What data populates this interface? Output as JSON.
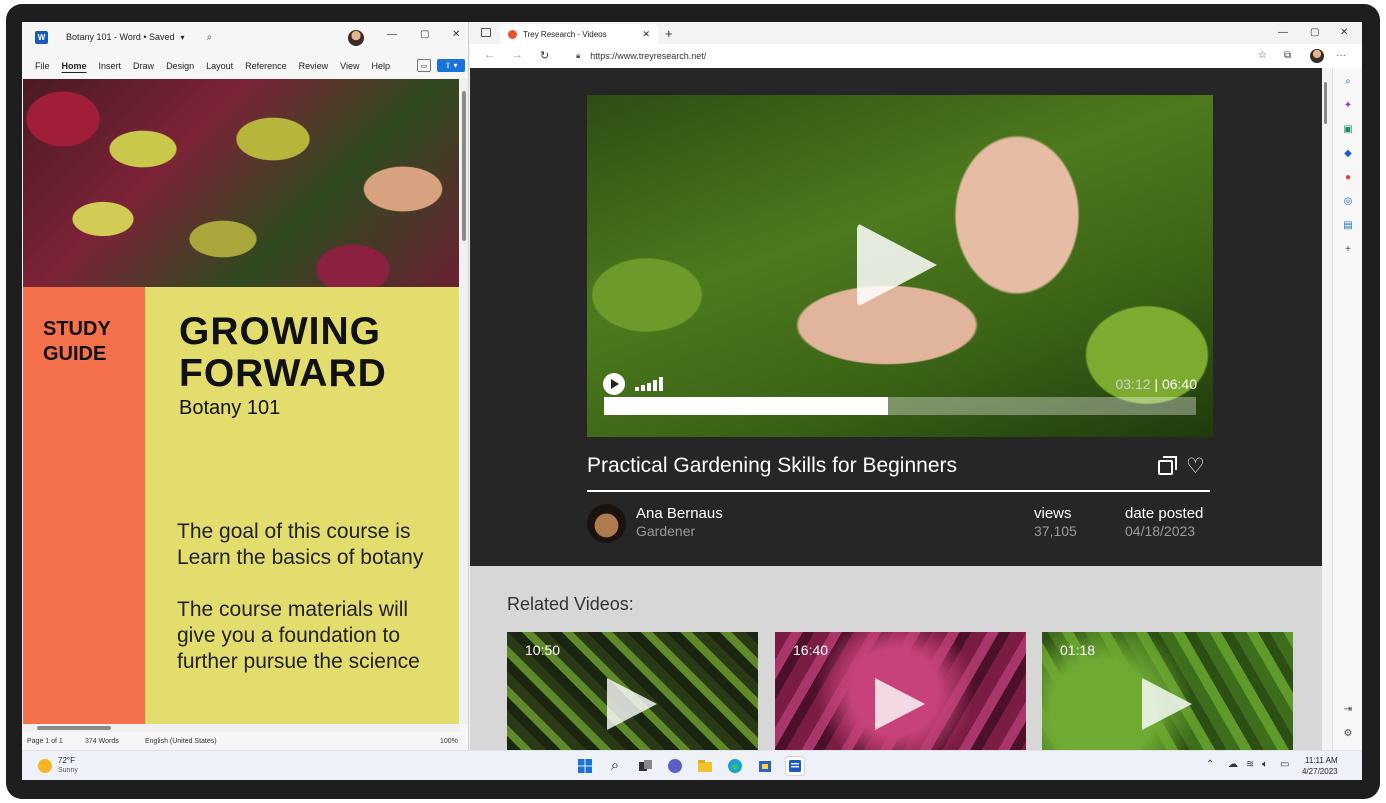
{
  "word": {
    "app_logo": "W",
    "doc_title": "Botany 101 - Word • Saved",
    "title_dropdown": "▾",
    "menu": [
      "File",
      "Home",
      "Insert",
      "Draw",
      "Design",
      "Layout",
      "Reference",
      "Review",
      "View",
      "Help"
    ],
    "active_menu": "Home",
    "document": {
      "study_guide": "STUDY\nGUIDE",
      "headline": "GROWING\nFORWARD",
      "subtitle": "Botany 101",
      "paragraph1": "The goal of this course is\nLearn the basics of botany",
      "paragraph2": "The course materials will\ngive you a foundation to\nfurther pursue the science"
    },
    "status": {
      "page": "Page 1 of 1",
      "words": "374 Words",
      "language": "English (United States)",
      "zoom": "100%"
    }
  },
  "browser": {
    "tab_title": "Trey Research - Videos",
    "url": "https://www.treyresearch.net/",
    "video": {
      "current_time": "03:12",
      "separator": " | ",
      "duration": "06:40",
      "progress_percent": 48,
      "title": "Practical Gardening Skills for Beginners",
      "author_name": "Ana Bernaus",
      "author_role": "Gardener",
      "views_label": "views",
      "views_value": "37,105",
      "date_label": "date posted",
      "date_value": "04/18/2023"
    },
    "related": {
      "title": "Related Videos:",
      "items": [
        {
          "duration": "10:50"
        },
        {
          "duration": "16:40"
        },
        {
          "duration": "01:18"
        }
      ]
    }
  },
  "taskbar": {
    "temperature": "72°F",
    "condition": "Sunny",
    "time": "11:11 AM",
    "date": "4/27/2023"
  }
}
